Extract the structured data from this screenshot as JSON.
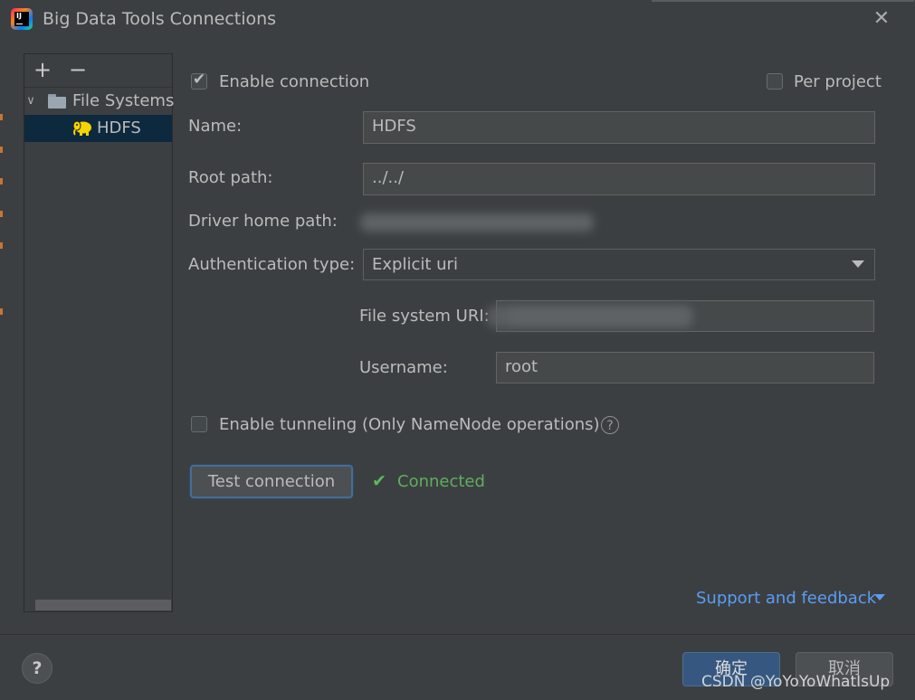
{
  "window": {
    "title": "Big Data Tools Connections",
    "close_glyph": "✕",
    "icon": "intellij-idea-icon"
  },
  "sidebar": {
    "add_glyph": "+",
    "remove_glyph": "−",
    "tree": {
      "group_label": "File Systems",
      "items": [
        {
          "label": "HDFS",
          "icon": "hadoop-elephant-icon",
          "selected": true
        }
      ]
    }
  },
  "form": {
    "enable_connection_label": "Enable connection",
    "enable_connection_checked": true,
    "per_project_label": "Per project",
    "per_project_checked": false,
    "name_label": "Name:",
    "name_value": "HDFS",
    "root_path_label": "Root path:",
    "root_path_value": "../../",
    "driver_home_label": "Driver home path:",
    "auth_type_label": "Authentication type:",
    "auth_type_value": "Explicit uri",
    "fs_uri_label": "File system URI:",
    "username_label": "Username:",
    "username_value": "root",
    "tunneling_label": "Enable tunneling (Only NameNode operations)",
    "tunneling_checked": false,
    "help_glyph": "?",
    "test_button_label": "Test connection",
    "status_check_glyph": "✔",
    "status_text": "Connected",
    "support_link": "Support and feedback"
  },
  "footer": {
    "help_glyph": "?",
    "ok_label": "确定",
    "cancel_label": "取消",
    "watermark": "CSDN @YoYoYoWhatIsUp"
  },
  "colors": {
    "background": "#3c3f41",
    "selection": "#0d293e",
    "link": "#589df6",
    "success": "#5fb65f",
    "default_button": "#365880"
  }
}
